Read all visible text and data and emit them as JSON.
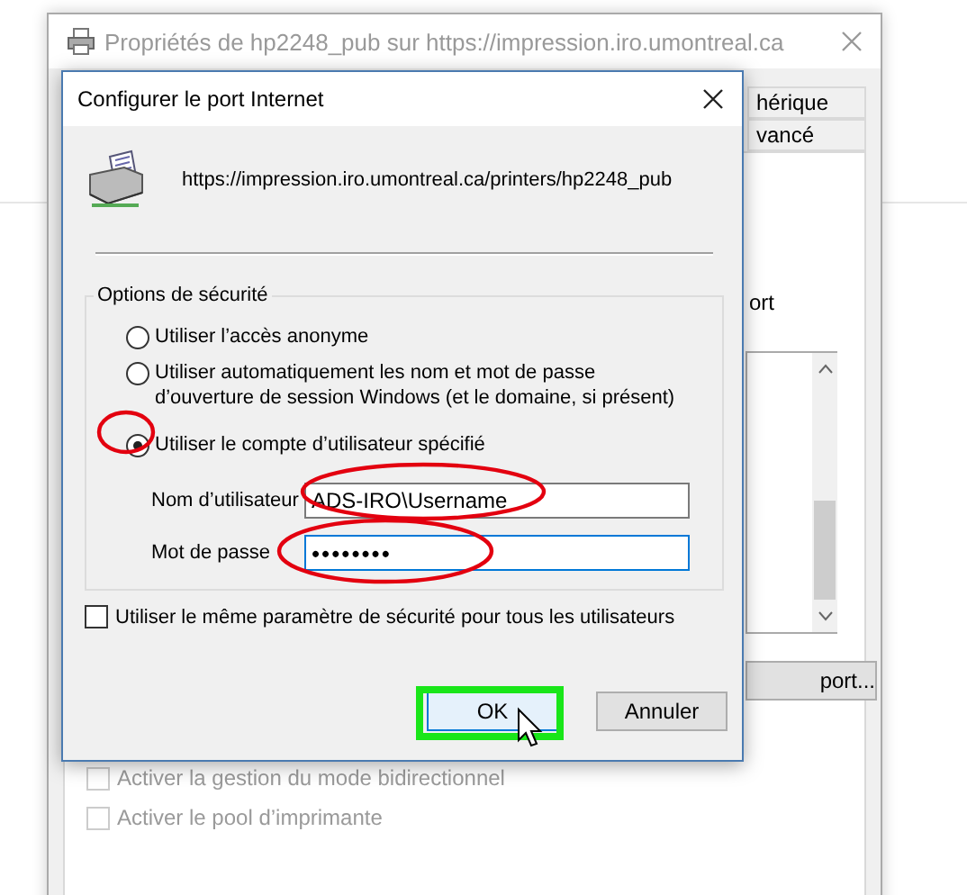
{
  "background_window": {
    "title": "Propriétés de hp2248_pub sur https://impression.iro.umontreal.ca",
    "active": false,
    "tabs": [
      {
        "label": "hérique",
        "selected": false
      },
      {
        "label": "vancé",
        "selected": false
      }
    ],
    "port_label": "ort",
    "configure_button": "port...",
    "options": [
      {
        "label": "Activer la gestion du mode bidirectionnel",
        "checked": false,
        "disabled": true
      },
      {
        "label": "Activer le pool d’imprimante",
        "checked": false,
        "disabled": true
      }
    ]
  },
  "dialog": {
    "title": "Configurer le port Internet",
    "url": "https://impression.iro.umontreal.ca/printers/hp2248_pub",
    "security_group": {
      "title": "Options de sécurité",
      "options": [
        {
          "label": "Utiliser l’accès anonyme",
          "selected": false
        },
        {
          "label": "Utiliser automatiquement les nom et mot de passe d’ouverture de session Windows (et le domaine, si présent)",
          "selected": false
        },
        {
          "label": "Utiliser le compte d’utilisateur spécifié",
          "selected": true
        }
      ],
      "username": {
        "label": "Nom d’utilisateur",
        "value": "ADS-IRO\\Username",
        "focused": false
      },
      "password": {
        "label": "Mot de passe",
        "value": "••••••••",
        "focused": true
      }
    },
    "same_for_all": {
      "label": "Utiliser le même paramètre de sécurité pour tous les utilisateurs",
      "checked": false
    },
    "buttons": [
      {
        "label": "OK",
        "default": true
      },
      {
        "label": "Annuler",
        "default": false
      }
    ]
  }
}
